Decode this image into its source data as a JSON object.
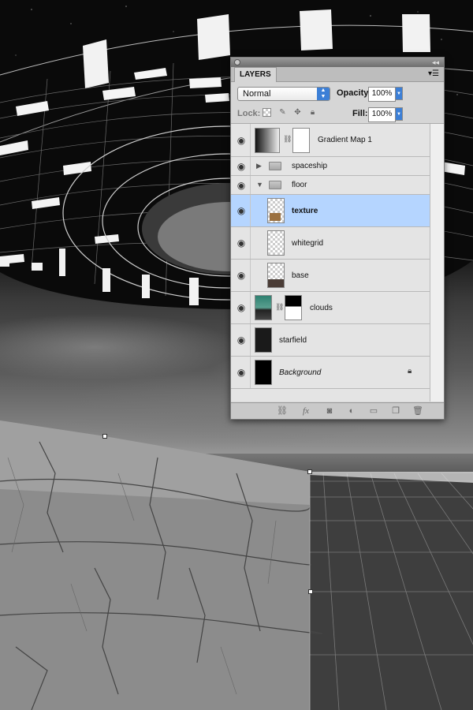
{
  "panel": {
    "tab_label": "LAYERS",
    "blend_mode": "Normal",
    "opacity_label": "Opacity:",
    "opacity_value": "100%",
    "lock_label": "Lock:",
    "fill_label": "Fill:",
    "fill_value": "100%",
    "layers": [
      {
        "name": "Gradient Map 1",
        "kind": "adjustment",
        "visible": true
      },
      {
        "name": "spaceship",
        "kind": "group-collapsed",
        "visible": true
      },
      {
        "name": "floor",
        "kind": "group-expanded",
        "visible": true
      },
      {
        "name": "texture",
        "kind": "layer",
        "visible": true,
        "selected": true
      },
      {
        "name": "whitegrid",
        "kind": "layer",
        "visible": true
      },
      {
        "name": "base",
        "kind": "layer",
        "visible": true
      },
      {
        "name": "clouds",
        "kind": "layer-with-mask",
        "visible": true
      },
      {
        "name": "starfield",
        "kind": "layer",
        "visible": true
      },
      {
        "name": "Background",
        "kind": "background-locked",
        "visible": true
      }
    ],
    "icons": {
      "visibility": "eye-icon",
      "lock": "lock-icon",
      "link": "link-icon",
      "fx": "fx-icon",
      "mask": "mask-icon",
      "adjustment": "adjustment-icon",
      "group": "folder-icon",
      "new_layer": "new-layer-icon",
      "delete": "trash-icon"
    },
    "colors": {
      "selection": "#b5d5ff",
      "accent": "#3c7fd6"
    }
  }
}
